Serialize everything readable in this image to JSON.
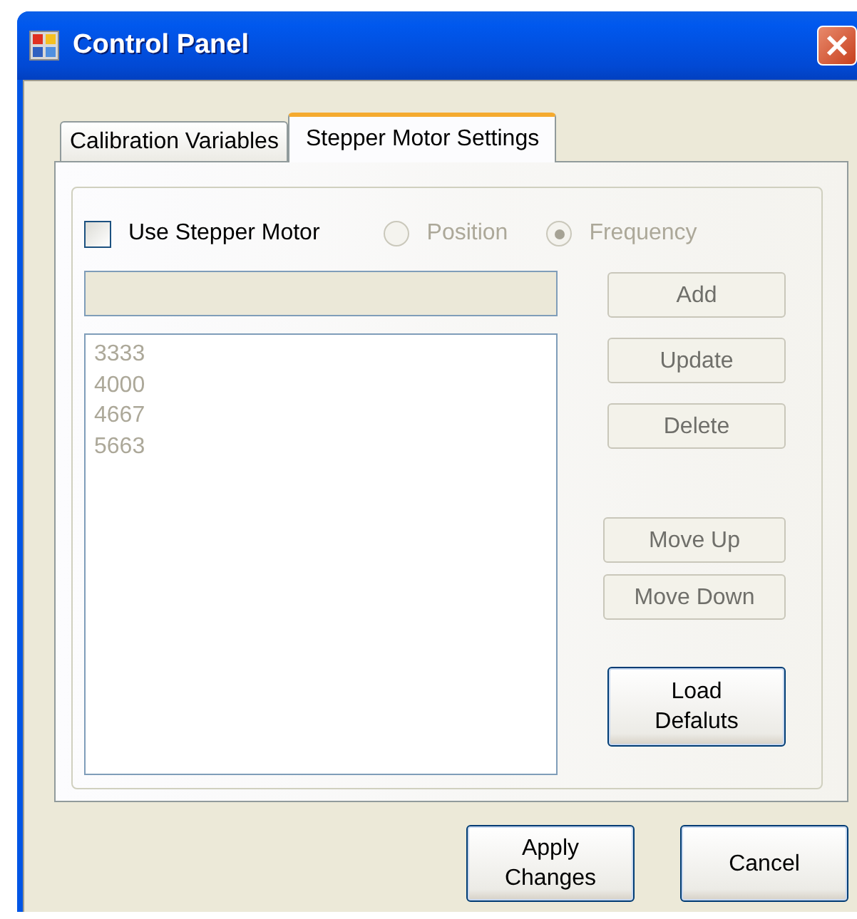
{
  "window": {
    "title": "Control Panel"
  },
  "tabs": [
    {
      "label": "Calibration Variables",
      "selected": false
    },
    {
      "label": "Stepper Motor Settings",
      "selected": true
    }
  ],
  "use_stepper_motor": {
    "label": "Use Stepper Motor",
    "checked": false
  },
  "mode_options": [
    {
      "label": "Position",
      "selected": false,
      "disabled": true
    },
    {
      "label": "Frequency",
      "selected": true,
      "disabled": true
    }
  ],
  "value_field": {
    "disabled": true
  },
  "list": {
    "disabled": true,
    "items": [
      "3333",
      "4000",
      "4667",
      "5663"
    ]
  },
  "button_groups": [
    [
      {
        "label": "Add",
        "disabled": true
      },
      {
        "label": "Update",
        "disabled": true
      },
      {
        "label": "Delete",
        "disabled": true
      }
    ],
    [
      {
        "label": "Move Up",
        "disabled": true
      },
      {
        "label": "Move Down",
        "disabled": true
      }
    ],
    [
      {
        "label": "Load\nDefaluts",
        "disabled": false
      }
    ]
  ],
  "dialog_buttons": [
    {
      "label": "Apply\nChanges",
      "disabled": false
    },
    {
      "label": "Cancel",
      "disabled": false
    }
  ]
}
